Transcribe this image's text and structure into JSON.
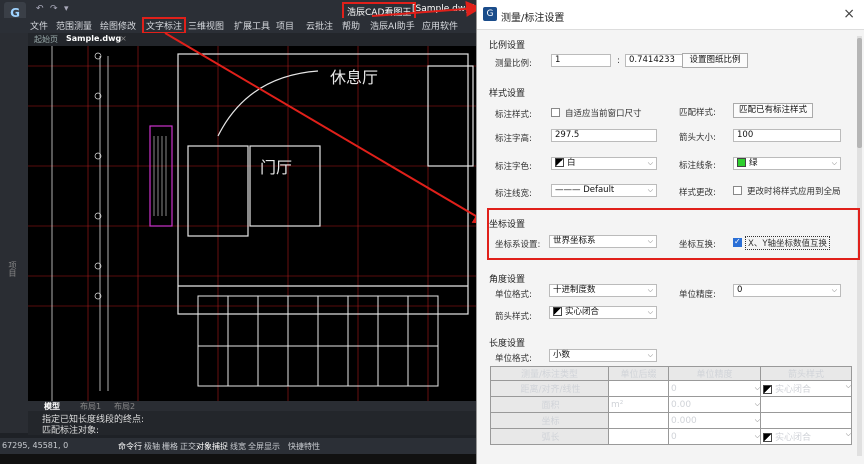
{
  "app": {
    "title": "浩辰CAD看图王",
    "file_title": "[Sample.dwg]",
    "menu": [
      "文件",
      "范围测量",
      "绘图修改",
      "文字标注",
      "三维视图",
      "扩展工具",
      "项目",
      "云批注",
      "帮助",
      "浩辰AI助手",
      "应用软件"
    ],
    "tabs": [
      "起始页",
      "Sample.dwg"
    ],
    "left_label": "项目",
    "layout_tabs": [
      "模型",
      "布局1",
      "布局2"
    ],
    "command_lines": [
      "指定已知长度线段的终点:",
      "匹配标注对象:"
    ],
    "coords": "67295, 45581, 0",
    "status": [
      "命令行",
      "极轴",
      "栅格",
      "正交",
      "对象捕捉",
      "线宽",
      "全屏显示",
      "快捷特性"
    ],
    "cad_labels": {
      "lounge": "休息厅",
      "hall": "门厅"
    },
    "colors": {
      "highlight": "#e0201a",
      "accent": "#2a6fd6"
    }
  },
  "dialog": {
    "title": "测量/标注设置",
    "scale": {
      "section": "比例设置",
      "label": "测量比例:",
      "a": "1",
      "colon": ":",
      "b": "0.7414233",
      "button": "设置图纸比例"
    },
    "style": {
      "section": "样式设置",
      "pos_label": "标注样式:",
      "pos_check": "自适应当前窗口尺寸",
      "match_label": "匹配样式:",
      "match_button": "匹配已有标注样式",
      "height_label": "标注字高:",
      "height_value": "297.5",
      "arrow_label": "箭头大小:",
      "arrow_value": "100",
      "color_label": "标注字色:",
      "color_value": "白",
      "line_label": "标注线条:",
      "line_value": "绿",
      "linetype_label": "标注线宽:",
      "linetype_value": "——— Default",
      "apply_label": "样式更改:",
      "apply_check": "更改时将样式应用到全局"
    },
    "coord": {
      "section": "坐标设置",
      "system_label": "坐标系设置:",
      "system_value": "世界坐标系",
      "swap_label": "坐标互换:",
      "swap_value": "X、Y轴坐标数值互换"
    },
    "angle": {
      "section": "角度设置",
      "unit_label": "单位格式:",
      "unit_value": "十进制度数",
      "precision_label": "单位精度:",
      "precision_value": "0",
      "arrow_label": "箭头样式:",
      "arrow_value": "实心闭合"
    },
    "length": {
      "section": "长度设置",
      "unit_label": "单位格式:",
      "unit_value": "小数",
      "headers": [
        "测量/标注类型",
        "单位后缀",
        "单位精度",
        "箭头样式"
      ],
      "rows": [
        [
          "距离/对齐/线性",
          "",
          "0",
          "实心闭合"
        ],
        [
          "面积",
          "m²",
          "0.00",
          ""
        ],
        [
          "坐标",
          "",
          "0.000",
          ""
        ],
        [
          "弧长",
          "",
          "0",
          "实心闭合"
        ]
      ]
    }
  }
}
